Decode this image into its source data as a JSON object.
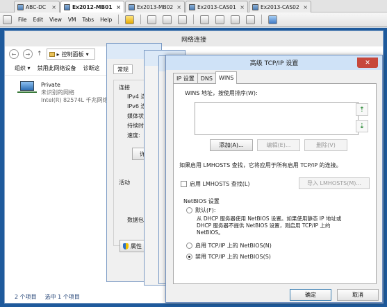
{
  "vm_tabs": [
    {
      "label": "ABC-DC",
      "active": false
    },
    {
      "label": "Ex2012-MB01",
      "active": true
    },
    {
      "label": "Ex2013-MB02",
      "active": false
    },
    {
      "label": "Ex2013-CAS01",
      "active": false
    },
    {
      "label": "Ex2013-CAS02",
      "active": false
    }
  ],
  "vm_tab_close": "×",
  "vm_menu": [
    "File",
    "Edit",
    "View",
    "VM",
    "Tabs",
    "Help"
  ],
  "net_window": {
    "title": "网络连接",
    "address": "控制面板",
    "address_chevron": "▸",
    "address_dropdown": "▾",
    "nav_back": "←",
    "nav_forward": "→",
    "nav_up": "↑",
    "cmd_organize": "组织 ▾",
    "cmd_disable": "禁用此网络设备",
    "cmd_diagnose": "诊断这",
    "adapter": {
      "name": "Private",
      "status": "未识别的网络",
      "device": "Intel(R) 82574L 千兆网络"
    },
    "status_items": "2 个项目",
    "status_selected": "选中 1 个项目"
  },
  "props_dialog": {
    "tab_general": "常规",
    "label_connect": "连接",
    "rows": [
      "IPv4 连",
      "IPv6 连",
      "媒体状",
      "持续时",
      "速度:"
    ],
    "details_button": "详",
    "label_activity": "活动",
    "label_packets": "数据包",
    "props_button": "属性"
  },
  "tcpip": {
    "title": "高级 TCP/IP 设置",
    "close": "✕",
    "tabs": [
      "IP 设置",
      "DNS",
      "WINS"
    ],
    "active_tab": "WINS",
    "wins_label": "WINS 地址，按使用排序(W):",
    "up_arrow": "⇡",
    "down_arrow": "⇣",
    "add_button": "添加(A)...",
    "edit_button": "编辑(E)...",
    "remove_button": "删除(V)",
    "lmhosts_note": "如果启用 LMHOSTS 查找，它将应用于所有启用 TCP/IP 的连接。",
    "lmhosts_checkbox": "启用 LMHOSTS 查找(L)",
    "import_button": "导入 LMHOSTS(M)...",
    "netbios_group": "NetBIOS 设置",
    "radio_default": "默认(F):",
    "radio_default_desc_1": "从 DHCP 服务器使用 NetBIOS 设置。如果使用静态 IP 地址或",
    "radio_default_desc_2": "DHCP 服务器不提供 NetBIOS 设置，则启用 TCP/IP 上的",
    "radio_default_desc_3": "NetBIOS。",
    "radio_enable": "启用 TCP/IP 上的 NetBIOS(N)",
    "radio_disable": "禁用 TCP/IP 上的 NetBIOS(S)",
    "selected_radio": "disable",
    "ok_button": "确定",
    "cancel_button": "取消"
  }
}
